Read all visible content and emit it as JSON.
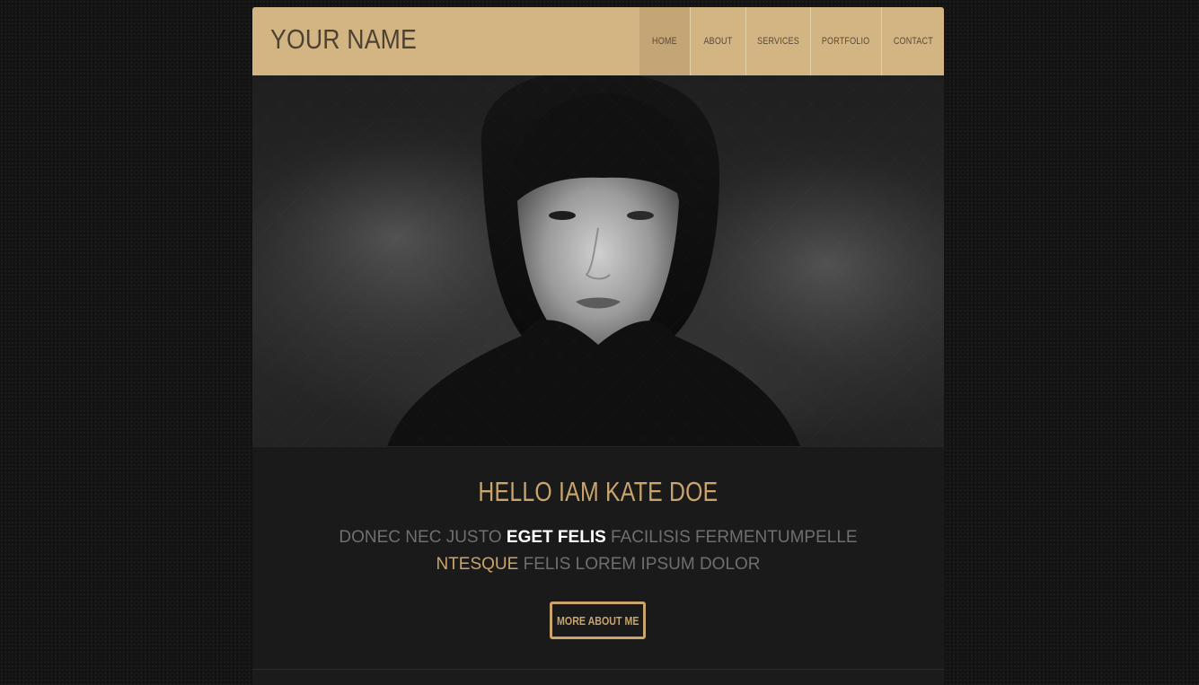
{
  "header": {
    "brand": "YOUR NAME",
    "nav": [
      {
        "label": "HOME",
        "active": true
      },
      {
        "label": "ABOUT",
        "active": false
      },
      {
        "label": "SERVICES",
        "active": false
      },
      {
        "label": "PORTFOLIO",
        "active": false
      },
      {
        "label": "CONTACT",
        "active": false
      }
    ]
  },
  "hero": {
    "image": "portrait-photo"
  },
  "intro": {
    "title": "HELLO IAM KATE DOE",
    "text_part1": "DONEC NEC JUSTO ",
    "text_highlight1": "EGET FELIS",
    "text_part2": " FACILISIS FERMENTUMPELLE ",
    "text_highlight2": "NTESQUE",
    "text_part3": " FELIS LOREM IPSUM DOLOR",
    "button_label": "MORE ABOUT ME"
  },
  "colors": {
    "accent": "#c9a46b",
    "header_bg": "#d3b584",
    "page_bg": "#141414"
  }
}
